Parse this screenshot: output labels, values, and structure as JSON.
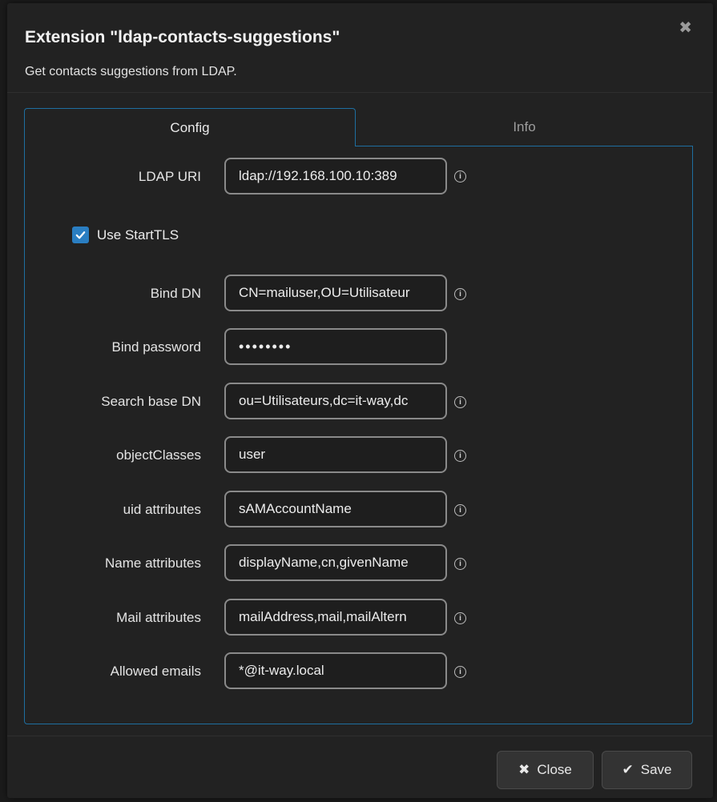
{
  "modal": {
    "title": "Extension \"ldap-contacts-suggestions\"",
    "description": "Get contacts suggestions from LDAP.",
    "close_glyph": "✖"
  },
  "tabs": [
    {
      "label": "Config",
      "active": true
    },
    {
      "label": "Info",
      "active": false
    }
  ],
  "form": {
    "ldap_uri": {
      "label": "LDAP URI",
      "value": "ldap://192.168.100.10:389"
    },
    "starttls": {
      "label": "Use StartTLS",
      "checked": true
    },
    "bind_dn": {
      "label": "Bind DN",
      "value": "CN=mailuser,OU=Utilisateur"
    },
    "bind_password": {
      "label": "Bind password",
      "value": "••••••••"
    },
    "search_base_dn": {
      "label": "Search base DN",
      "value": "ou=Utilisateurs,dc=it-way,dc"
    },
    "object_classes": {
      "label": "objectClasses",
      "value": "user"
    },
    "uid_attributes": {
      "label": "uid attributes",
      "value": "sAMAccountName"
    },
    "name_attributes": {
      "label": "Name attributes",
      "value": "displayName,cn,givenName"
    },
    "mail_attributes": {
      "label": "Mail attributes",
      "value": "mailAddress,mail,mailAltern"
    },
    "allowed_emails": {
      "label": "Allowed emails",
      "value": "*@it-way.local"
    }
  },
  "footer": {
    "close_label": "Close",
    "close_icon": "✖",
    "save_label": "Save",
    "save_icon": "✔"
  },
  "icons": {
    "info": "i"
  },
  "colors": {
    "accent": "#1e6fa0",
    "checkbox": "#2a7ec2",
    "modal_bg": "#222222"
  }
}
